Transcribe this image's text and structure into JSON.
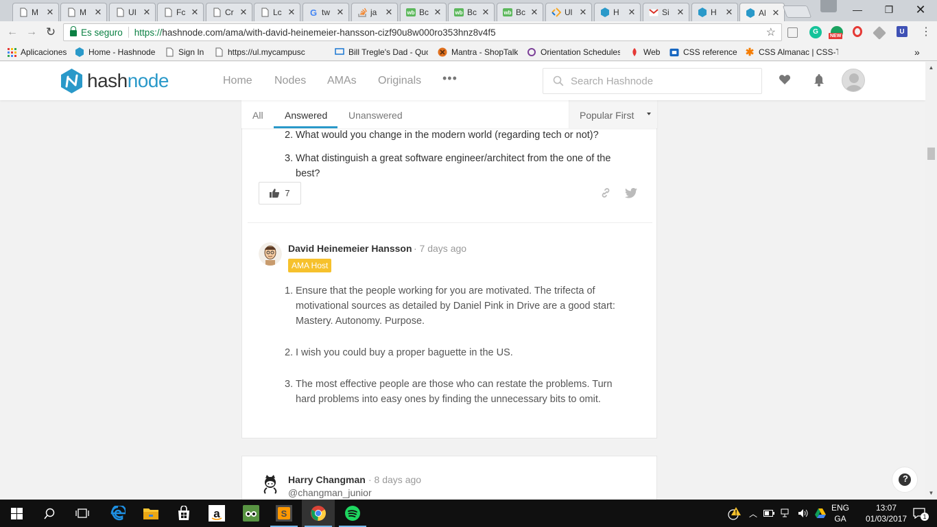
{
  "browser": {
    "tabs": [
      {
        "title": "M",
        "icon": "doc-icon"
      },
      {
        "title": "M",
        "icon": "doc-icon"
      },
      {
        "title": "UI",
        "icon": "doc-icon"
      },
      {
        "title": "Fc",
        "icon": "doc-icon"
      },
      {
        "title": "Cr",
        "icon": "doc-icon"
      },
      {
        "title": "Lc",
        "icon": "doc-icon"
      },
      {
        "title": "tw",
        "icon": "google-icon"
      },
      {
        "title": "ja",
        "icon": "stackoverflow-icon"
      },
      {
        "title": "Bc",
        "icon": "wb-icon"
      },
      {
        "title": "Bc",
        "icon": "wb-icon"
      },
      {
        "title": "Bc",
        "icon": "wb-icon"
      },
      {
        "title": "Ul",
        "icon": "sketch-icon"
      },
      {
        "title": "H",
        "icon": "hashnode-icon"
      },
      {
        "title": "Si",
        "icon": "gmail-icon"
      },
      {
        "title": "H",
        "icon": "hashnode-icon"
      },
      {
        "title": "Al",
        "icon": "hashnode-icon"
      }
    ],
    "secure_label": "Es seguro",
    "url_scheme": "https://",
    "url_rest": "hashnode.com/ama/with-david-heinemeier-hansson-cizf90u8w000ro353hnz8v4f5",
    "ext_new_label": "NEW",
    "bookmarks": [
      {
        "label": "Aplicaciones",
        "icon": "apps-grid-icon"
      },
      {
        "label": "Home - Hashnode",
        "icon": "hashnode-icon"
      },
      {
        "label": "Sign In",
        "icon": "doc-icon"
      },
      {
        "label": "https://ul.mycampusc",
        "icon": "doc-icon"
      },
      {
        "label": "Bill Tregle's Dad - Quo",
        "icon": "monitor-icon"
      },
      {
        "label": "Mantra - ShopTalk",
        "icon": "shoptalk-icon"
      },
      {
        "label": "Orientation Schedules",
        "icon": "orientation-icon"
      },
      {
        "label": "Web",
        "icon": "web-icon"
      },
      {
        "label": "CSS reference",
        "icon": "css-icon"
      },
      {
        "label": "CSS Almanac | CSS-Tri",
        "icon": "css-tricks-icon"
      }
    ],
    "more_bookmarks": "»"
  },
  "site": {
    "logo_part1": "hash",
    "logo_part2": "node",
    "nav": [
      "Home",
      "Nodes",
      "AMAs",
      "Originals"
    ],
    "nav_more": "•••",
    "search_placeholder": "Search Hashnode",
    "brand_color": "#2a99c9"
  },
  "filters": {
    "tabs": [
      "All",
      "Answered",
      "Unanswered"
    ],
    "active": "Answered",
    "sort": "Popular First"
  },
  "question": {
    "items": [
      {
        "num": "2.",
        "text": "What would you change in the modern world (regarding tech or not)?"
      },
      {
        "num": "3.",
        "text_line1": "What distinguish a great software engineer/architect from the one of the",
        "text_line2": "best?"
      }
    ],
    "upvotes": "7"
  },
  "answer": {
    "author": "David Heinemeier Hansson",
    "time": "· 7 days ago",
    "badge": "AMA Host",
    "badge_color": "#f6c12c",
    "items": [
      {
        "num": "1.",
        "lines": [
          "Ensure that the people working for you are motivated. The trifecta of",
          "motivational sources as detailed by Daniel Pink in Drive are a good start:",
          "Mastery. Autonomy. Purpose."
        ]
      },
      {
        "num": "2.",
        "lines": [
          "I wish you could buy a proper baguette in the US."
        ]
      },
      {
        "num": "3.",
        "lines": [
          "The most effective people are those who can restate the problems. Turn",
          "hard problems into easy ones by finding the unnecessary bits to omit."
        ]
      }
    ]
  },
  "next_question": {
    "author": "Harry Changman",
    "time": "· 8 days ago",
    "handle": "@changman_junior"
  },
  "help_label": "?",
  "taskbar": {
    "lang_line1": "ENG",
    "lang_line2": "GA",
    "time": "13:07",
    "date": "01/03/2017",
    "notifications": "1"
  }
}
